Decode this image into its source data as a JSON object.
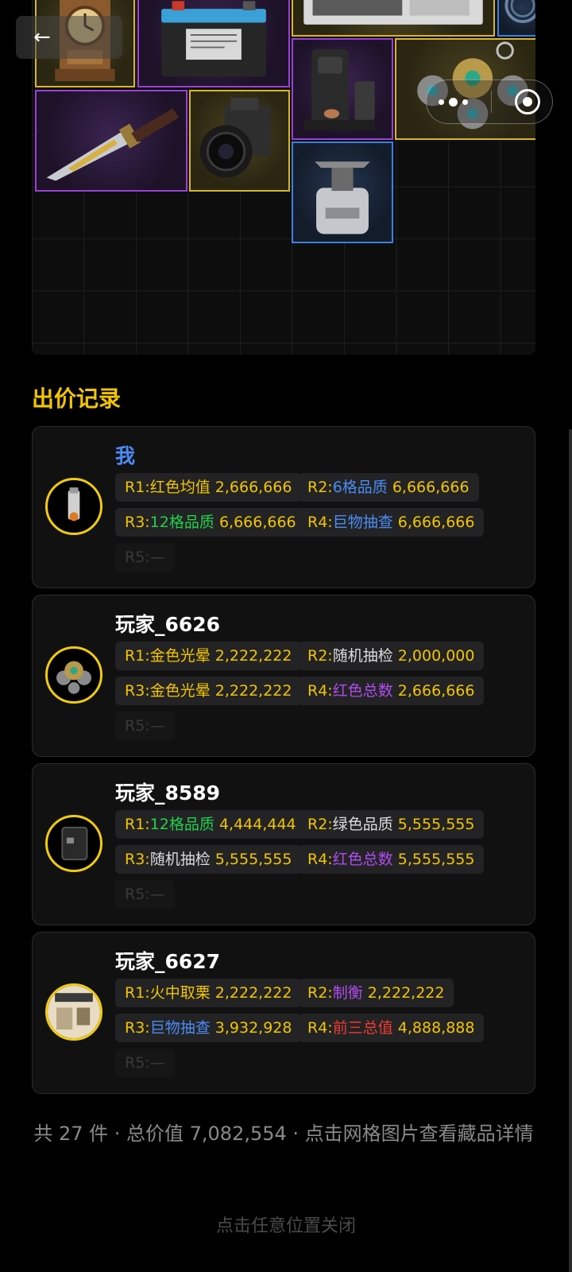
{
  "nav": {
    "back_icon": "←"
  },
  "capsule": {
    "more_icon": "more-dots-icon",
    "target_icon": "target-icon"
  },
  "inventory_items": [
    {
      "name": "ornate-clock",
      "rarity": "gold"
    },
    {
      "name": "car-battery",
      "rarity": "purple"
    },
    {
      "name": "server-unit",
      "rarity": "gold"
    },
    {
      "name": "cable-coil",
      "rarity": "blue"
    },
    {
      "name": "hunting-knife",
      "rarity": "purple"
    },
    {
      "name": "medium-format-camera",
      "rarity": "gold"
    },
    {
      "name": "coffee-machine",
      "rarity": "purple"
    },
    {
      "name": "jeweled-keychain",
      "rarity": "gold"
    },
    {
      "name": "camp-stove",
      "rarity": "blue"
    }
  ],
  "bids": {
    "title": "出价记录",
    "records": [
      {
        "player": "我",
        "is_me": true,
        "avatar": "lighter",
        "rounds": [
          {
            "prefix": "R1:",
            "rule": "红色均值",
            "rule_color": "#f2c500",
            "value": "2,666,666"
          },
          {
            "prefix": "R2:",
            "rule": "6格品质",
            "rule_color": "#4a8cf5",
            "value": "6,666,666"
          },
          {
            "prefix": "R3:",
            "rule": "12格品质",
            "rule_color": "#22d04a",
            "value": "6,666,666"
          },
          {
            "prefix": "R4:",
            "rule": "巨物抽查",
            "rule_color": "#4a8cf5",
            "value": "6,666,666"
          }
        ],
        "r5": "R5:—"
      },
      {
        "player": "玩家_6626",
        "is_me": false,
        "avatar": "keychain",
        "rounds": [
          {
            "prefix": "R1:",
            "rule": "金色光晕",
            "rule_color": "#f2c500",
            "value": "2,222,222"
          },
          {
            "prefix": "R2:",
            "rule": "随机抽检",
            "rule_color": "#dcdcdc",
            "value": "2,000,000"
          },
          {
            "prefix": "R3:",
            "rule": "金色光晕",
            "rule_color": "#f2c500",
            "value": "2,222,222"
          },
          {
            "prefix": "R4:",
            "rule": "红色总数",
            "rule_color": "#b04df0",
            "value": "2,666,666"
          }
        ],
        "r5": "R5:—"
      },
      {
        "player": "玩家_8589",
        "is_me": false,
        "avatar": "notebook",
        "rounds": [
          {
            "prefix": "R1:",
            "rule": "12格品质",
            "rule_color": "#22d04a",
            "value": "4,444,444"
          },
          {
            "prefix": "R2:",
            "rule": "绿色品质",
            "rule_color": "#dcdcdc",
            "value": "5,555,555"
          },
          {
            "prefix": "R3:",
            "rule": "随机抽检",
            "rule_color": "#dcdcdc",
            "value": "5,555,555"
          },
          {
            "prefix": "R4:",
            "rule": "红色总数",
            "rule_color": "#b04df0",
            "value": "5,555,555"
          }
        ],
        "r5": "R5:—"
      },
      {
        "player": "玩家_6627",
        "is_me": false,
        "avatar": "poster",
        "rounds": [
          {
            "prefix": "R1:",
            "rule": "火中取栗",
            "rule_color": "#f2c500",
            "value": "2,222,222"
          },
          {
            "prefix": "R2:",
            "rule": "制衡",
            "rule_color": "#b04df0",
            "value": "2,222,222"
          },
          {
            "prefix": "R3:",
            "rule": "巨物抽查",
            "rule_color": "#4a8cf5",
            "value": "3,932,928"
          },
          {
            "prefix": "R4:",
            "rule": "前三总值",
            "rule_color": "#f03a2e",
            "value": "4,888,888"
          }
        ],
        "r5": "R5:—"
      }
    ]
  },
  "summary": "共 27 件 · 总价值 7,082,554 · 点击网格图片查看藏品详情",
  "close_hint": "点击任意位置关闭"
}
